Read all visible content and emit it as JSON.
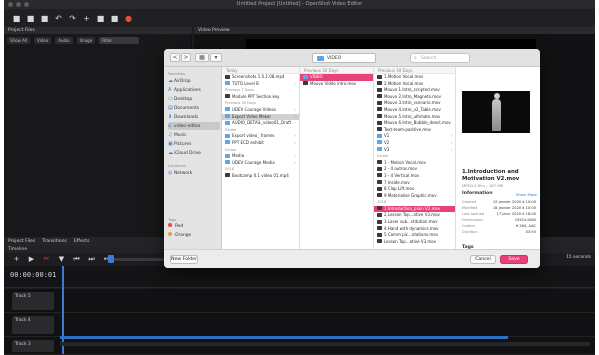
{
  "app": {
    "window_title": "Untitled Project [Untitled] - OpenShot Video Editor",
    "toolbar_icons": [
      "new-icon",
      "open-icon",
      "save-icon",
      "undo-icon",
      "redo-icon",
      "import-icon",
      "profile-icon",
      "export-icon"
    ],
    "record_color": "#e74c3c",
    "accent": "#3a7bd5"
  },
  "project_files": {
    "header": "Project Files",
    "filters": [
      "Show All",
      "Video",
      "Audio",
      "Image"
    ],
    "search_placeholder": "Filter"
  },
  "video_preview": {
    "header": "Video Preview"
  },
  "dialog": {
    "nav_back": "<",
    "nav_forward": ">",
    "view_icon": "▦",
    "location": "VIDEO",
    "search_placeholder": "Search",
    "sidebar": {
      "favourites_label": "Favorites",
      "items": [
        {
          "icon": "☁",
          "label": "AirDrop"
        },
        {
          "icon": "A",
          "label": "Applications"
        },
        {
          "icon": "▭",
          "label": "Desktop"
        },
        {
          "icon": "▤",
          "label": "Documents"
        },
        {
          "icon": "⬇",
          "label": "Downloads"
        },
        {
          "icon": "⌂",
          "label": "video-editor"
        },
        {
          "icon": "♫",
          "label": "Music"
        },
        {
          "icon": "▣",
          "label": "Pictures"
        },
        {
          "icon": "☁",
          "label": "iCloud Drive"
        }
      ],
      "locations_label": "Locations",
      "locations": [
        {
          "icon": "◎",
          "label": "Network"
        }
      ],
      "tags_label": "Tags",
      "tags": [
        {
          "label": "Red",
          "color": "#e84a4a"
        },
        {
          "label": "Orange",
          "color": "#f39c32"
        }
      ]
    },
    "col1": {
      "header": "Today",
      "rows": [
        {
          "type": "movie",
          "label": "Screenshots 1.0.1.08.mp4"
        },
        {
          "type": "folder",
          "label": "TUTO Level B",
          "chev": true
        },
        {
          "type": "group",
          "label": "Previous 7 Days"
        },
        {
          "type": "movie",
          "label": "Module PPT Section.key"
        },
        {
          "type": "group",
          "label": "Previous 30 Days"
        },
        {
          "type": "folder",
          "label": "UDEV Courage Videos",
          "chev": true
        },
        {
          "type": "folder",
          "label": "Export Video Maker",
          "chev": true,
          "sel": true
        },
        {
          "type": "folder",
          "label": "AUDIO_DETAIL_video01_Draft",
          "chev": true
        },
        {
          "type": "group",
          "label": "Earlier"
        },
        {
          "type": "folder",
          "label": "Export video_ frames",
          "chev": true
        },
        {
          "type": "folder",
          "label": "PPT ECD exhibit",
          "chev": true
        },
        {
          "type": "group",
          "label": "Earlier"
        },
        {
          "type": "folder",
          "label": "Media",
          "chev": true
        },
        {
          "type": "folder",
          "label": "UDEV Courage Media",
          "chev": true
        },
        {
          "type": "group",
          "label": "2018"
        },
        {
          "type": "movie",
          "label": "Bootcamp 0.1 video 01.mp4"
        }
      ]
    },
    "col2": {
      "header": "Previous 30 Days",
      "rows": [
        {
          "type": "folder",
          "label": "VIDEO",
          "chev": true,
          "hot": true
        },
        {
          "type": "movie",
          "label": "Mouvo Vidéo intro.mov"
        }
      ]
    },
    "col3": {
      "header": "Previous 30 Days",
      "rows": [
        {
          "type": "movie",
          "label": "1.Motion Vocal.mov"
        },
        {
          "type": "movie",
          "label": "2.Motion Vocal.mov"
        },
        {
          "type": "movie",
          "label": "Mouvo 1.Intro_scripted.mov"
        },
        {
          "type": "movie",
          "label": "Mouvo 2.Intro_Magneto.mov"
        },
        {
          "type": "movie",
          "label": "Mouvo 3.Intro_scenario.mov"
        },
        {
          "type": "movie",
          "label": "Mouvo 4.Intro_v2_Table.mov"
        },
        {
          "type": "movie",
          "label": "Mouvo 5.Intro_ultimate.mov"
        },
        {
          "type": "movie",
          "label": "Mouvo 6.Intro_Bubble_deact.mov"
        },
        {
          "type": "movie",
          "label": "Text-team-positive.mov"
        },
        {
          "type": "folder",
          "label": "V1",
          "chev": true
        },
        {
          "type": "folder",
          "label": "V2",
          "chev": true
        },
        {
          "type": "folder",
          "label": "V3",
          "chev": true
        },
        {
          "type": "group",
          "label": "Earlier"
        },
        {
          "type": "movie",
          "label": "1 - Motion Vocal.mov"
        },
        {
          "type": "movie",
          "label": "2 - 4 outros.mov"
        },
        {
          "type": "movie",
          "label": "3 - 4 Vertical.mov"
        },
        {
          "type": "movie",
          "label": "7 Inside.mov"
        },
        {
          "type": "movie",
          "label": "8 Clap Lift.mov"
        },
        {
          "type": "movie",
          "label": "9 Materialise Graphic.mov"
        },
        {
          "type": "group",
          "label": "2018"
        },
        {
          "type": "movie",
          "label": "1.Introduction_plain V2.mov",
          "hot": true
        },
        {
          "type": "movie",
          "label": "2.Lesson Top...ative V3.mov"
        },
        {
          "type": "movie",
          "label": "3.Laser sub...stitution.mov"
        },
        {
          "type": "movie",
          "label": "4.Hand with dynamics.mov"
        },
        {
          "type": "movie",
          "label": "5 Comm pic...ntations.mov"
        },
        {
          "type": "movie",
          "label": "Lesson Top...ative V3.mov"
        }
      ]
    },
    "preview": {
      "title": "1.Introduction and Motivation V2.mov",
      "subtitle": "MPEG-4 film - 167 MB",
      "info_label": "Information",
      "show_more": "Show More",
      "info": [
        {
          "k": "Created",
          "v": "19 janvier 2020 à 10:00"
        },
        {
          "k": "Modified",
          "v": "18 janvier 2020 à 10:00"
        },
        {
          "k": "Last opened",
          "v": "17 janv. 2020 à 18:00"
        },
        {
          "k": "Dimensions",
          "v": "1920×1080"
        },
        {
          "k": "Codecs",
          "v": "H.264, AAC"
        },
        {
          "k": "Duration",
          "v": "03:50"
        }
      ],
      "tags_label": "Tags"
    },
    "new_folder_label": "New Folder",
    "cancel_label": "Cancel",
    "save_label": "Save"
  },
  "bottom": {
    "tabs": [
      "Project Files",
      "Transitions",
      "Effects"
    ],
    "timeline_label": "Timeline",
    "seconds_label": "15 seconds",
    "timecode": "00:00:00:01",
    "tracks": [
      "Track 5",
      "Track 4",
      "Track 3"
    ]
  }
}
